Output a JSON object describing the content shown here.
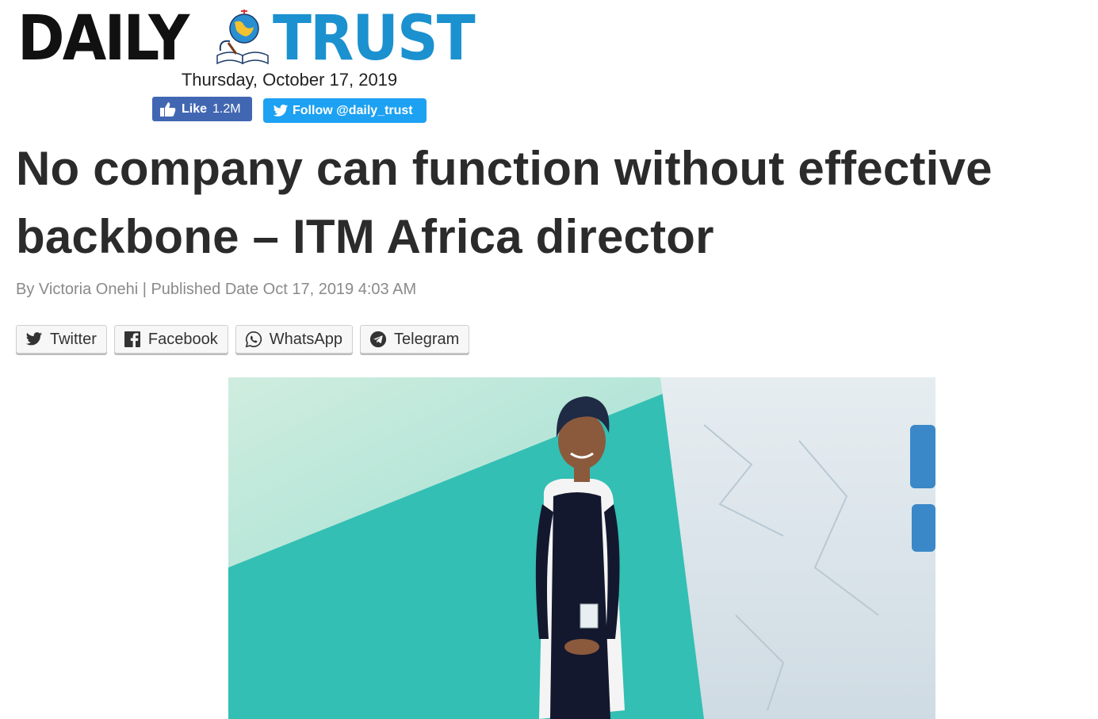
{
  "masthead": {
    "brand_part1": "DAILY",
    "brand_part2": "TRUST",
    "brand_color": "#1b91cf",
    "emblem_icon": "globe-book-emblem-icon"
  },
  "date_line": "Thursday, October 17, 2019",
  "social": {
    "facebook_like_label": "Like",
    "facebook_like_count": "1.2M",
    "facebook_color": "#4267b2",
    "twitter_follow_label": "Follow @daily_trust",
    "twitter_color": "#1da1f2"
  },
  "article": {
    "headline": "No company can function without effective backbone – ITM Africa director",
    "byline": "By Victoria Onehi | Published Date Oct 17, 2019 4:03 AM"
  },
  "share_buttons": [
    {
      "label": "Twitter",
      "icon": "twitter-icon"
    },
    {
      "label": "Facebook",
      "icon": "facebook-icon"
    },
    {
      "label": "WhatsApp",
      "icon": "whatsapp-icon"
    },
    {
      "label": "Telegram",
      "icon": "telegram-icon"
    }
  ]
}
